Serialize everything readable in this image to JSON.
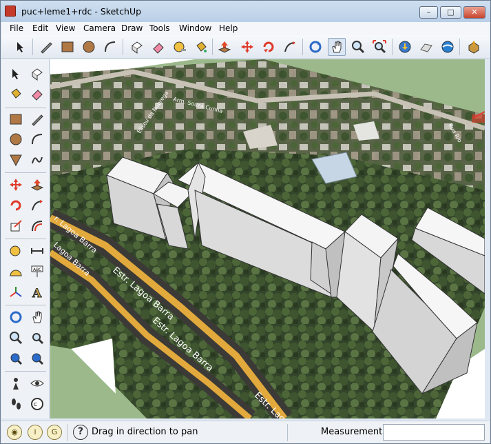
{
  "window": {
    "title": "puc+leme1+rdc - SketchUp"
  },
  "title_buttons": {
    "minimize": "–",
    "maximize": "□",
    "close": "✕"
  },
  "menu": [
    "File",
    "Edit",
    "View",
    "Camera",
    "Draw",
    "Tools",
    "Window",
    "Help"
  ],
  "toolbar_icons": [
    "select-icon",
    "pencil-icon",
    "rectangle-icon",
    "circle-icon",
    "arc-icon",
    "make-component-icon",
    "eraser-icon",
    "tape-measure-icon",
    "paint-bucket-icon",
    "push-pull-icon",
    "move-icon",
    "rotate-icon",
    "follow-me-icon",
    "orbit-icon",
    "pan-icon",
    "zoom-icon",
    "zoom-extents-icon",
    "add-location-icon",
    "toggle-terrain-icon",
    "get-models-icon",
    "share-model-icon"
  ],
  "map_labels": {
    "road1": "Estr. Lagoa Barra",
    "road2": "Estr. Lagoa Barra",
    "road3": "Estr. Lagoa Barra",
    "road_left": "r. Lagoa Barra",
    "road_left2": "Lagoa Barra",
    "street_top": "Arm. Souza Cunha",
    "street_top2": "Eliseu da Nobrega",
    "street_right": "Rua Rio"
  },
  "statusbar": {
    "help": "?",
    "status_text": "Drag in direction to pan",
    "measurements_label": "Measurements",
    "measurements_value": ""
  }
}
